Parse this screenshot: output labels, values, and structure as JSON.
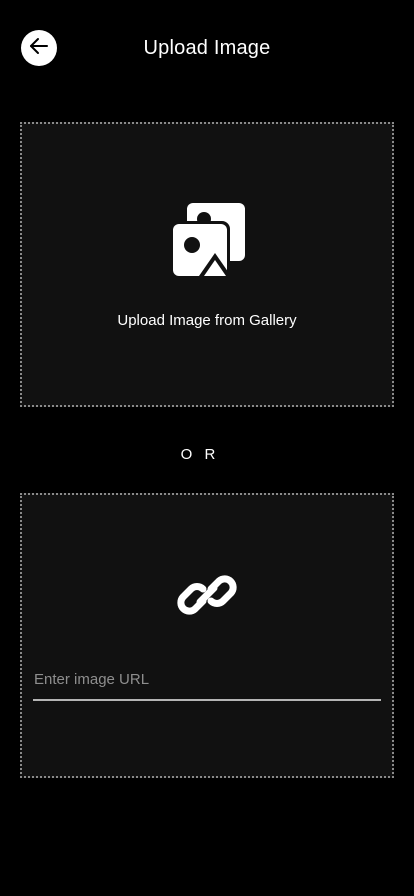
{
  "header": {
    "title": "Upload Image",
    "back_icon": "arrow-left-icon"
  },
  "gallery": {
    "icon": "images-icon",
    "label": "Upload Image from Gallery"
  },
  "separator": {
    "text": "O R"
  },
  "url_section": {
    "icon": "link-icon",
    "input_value": "",
    "input_placeholder": "Enter image URL"
  },
  "colors": {
    "background": "#000000",
    "panel": "#111111",
    "dotted_border": "#8a8a8a",
    "text": "#ffffff",
    "placeholder": "#8e8e8e",
    "underline": "#b5b5b5"
  }
}
